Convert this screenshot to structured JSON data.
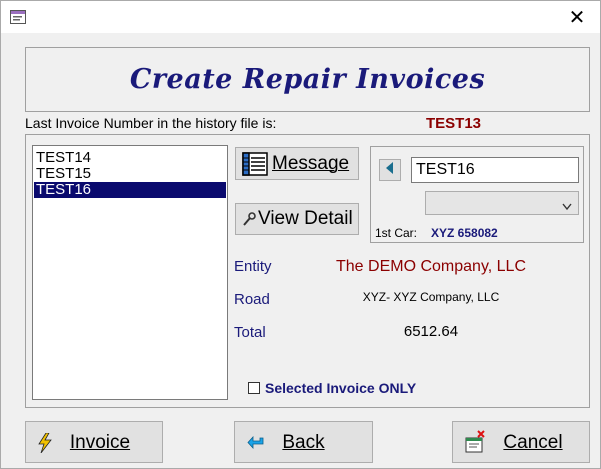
{
  "window": {
    "close_glyph": "✕",
    "app_icon": "form-icon"
  },
  "header": {
    "title": "Create Repair Invoices"
  },
  "last_invoice": {
    "label": "Last Invoice Number in the history file is:",
    "value": "TEST13"
  },
  "invoice_list": {
    "items": [
      "TEST14",
      "TEST15",
      "TEST16"
    ],
    "selected": "TEST16"
  },
  "buttons": {
    "message": "Message",
    "view_detail": "View Detail",
    "invoice": "Invoice",
    "back": "Back",
    "cancel": "Cancel"
  },
  "car_panel": {
    "invoice_value": "TEST16",
    "dropdown_value": "",
    "first_car_label": "1st Car:",
    "first_car_value": "XYZ 658082"
  },
  "info": {
    "entity_label": "Entity",
    "entity_value": "The DEMO Company, LLC",
    "road_label": "Road",
    "road_value": "XYZ- XYZ Company, LLC",
    "total_label": "Total",
    "total_value": "6512.64"
  },
  "options": {
    "selected_only_label": "Selected Invoice ONLY",
    "selected_only_checked": false
  },
  "colors": {
    "title": "#1a1a7a",
    "accent_red": "#8b0000",
    "selection": "#0a0a6e"
  }
}
